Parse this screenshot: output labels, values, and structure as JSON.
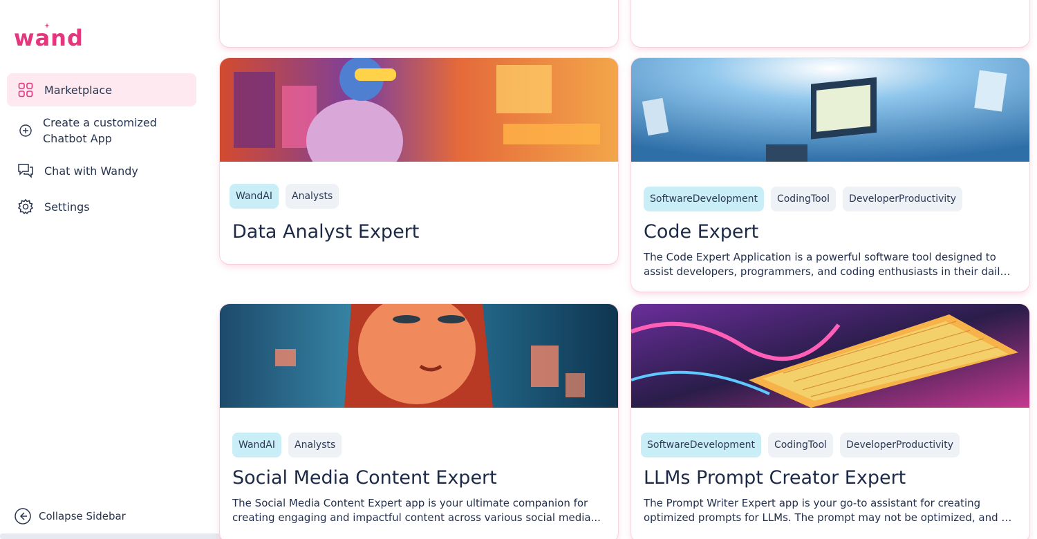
{
  "app": {
    "logo_text": "wand"
  },
  "sidebar": {
    "items": [
      {
        "label": "Marketplace",
        "icon": "grid-icon",
        "active": true
      },
      {
        "label_line1": "Create a customized",
        "label_line2": "Chatbot App",
        "icon": "plus-circle-icon"
      },
      {
        "label": "Chat with Wandy",
        "icon": "chat-icon"
      },
      {
        "label": "Settings",
        "icon": "gear-icon"
      }
    ],
    "collapse_label": "Collapse Sidebar"
  },
  "cards": [
    {
      "tags": [
        "WandAI",
        "Analysts"
      ],
      "title": "Data Analyst Expert",
      "desc": []
    },
    {
      "tags": [
        "SoftwareDevelopment",
        "CodingTool",
        "DeveloperProductivity"
      ],
      "title": "Code Expert",
      "desc": [
        "The Code Expert Application is a powerful software tool designed to",
        "assist developers, programmers, and coding enthusiasts in their daily..."
      ]
    },
    {
      "tags": [
        "WandAI",
        "Analysts"
      ],
      "title": "Social Media Content Expert",
      "desc": [
        "The Social Media Content Expert app is your ultimate companion for",
        "creating engaging and impactful content across various social media..."
      ]
    },
    {
      "tags": [
        "SoftwareDevelopment",
        "CodingTool",
        "DeveloperProductivity"
      ],
      "title": "LLMs Prompt Creator Expert",
      "desc": [
        "The Prompt Writer Expert app is your go-to assistant for creating",
        "optimized prompts for LLMs. The prompt may not be optimized, and it's..."
      ]
    }
  ],
  "colors": {
    "brand": "#e5357c",
    "active_bg": "#fde9ef",
    "tag_primary": "#c9eef7",
    "tag": "#eef1f6"
  }
}
